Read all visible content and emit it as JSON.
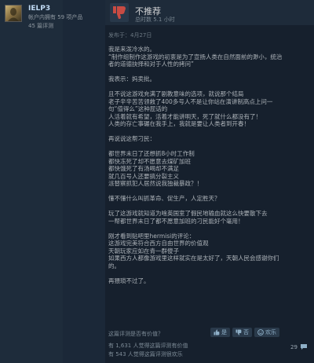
{
  "user": {
    "name": "IELP3",
    "games_owned": "帐户内拥有 59 项产品",
    "reviews_count": "45 篇评测"
  },
  "review": {
    "verdict": "不推荐",
    "hours": "总时数 5.1 小时",
    "posted": "发布于：4月27日",
    "lines": [
      "我是来泼冷水的。",
      "“制作组制作这游戏的初衷是为了宣扬人类在自然面前的渺小，统治",
      "者的道德抉择和对于人性的拷问”",
      "",
      "我表示：妈卖批。",
      "",
      "且不说这游戏充满了剧教意味的选项，就说那个结局",
      "老子辛辛苦苦领救了400多号人不是让你站在演讲制高点上问一",
      "句“值得么”这种屁话的",
      "人活着就有希望，活着才能讲明天，死了就什么都没有了！",
      "人类的存亡事碾在我手上，我就是要让人类者到开春！",
      "",
      "再说说这帮刁民：",
      "",
      "都世界末日了还想抓8小时工作制",
      "都快冻死了却不愿意去煤矿加班",
      "都快饿死了有汤喝却不满足",
      "就几百号人还要搞分裂主义",
      "派替察抓犯人居然说我独裁暴政？！",
      "",
      "懂不懂什么叫抓革命、促生产，人定胜天？",
      "",
      "玩了这游戏就知道为啥英国室了假民地输血就这么快要散下去",
      "一帮都世界末日了都不愿意加班的刁民能好个毫用！",
      "",
      "刚才看到贴吧里hermisi的评论：",
      "这游戏完美符合西方自由世界的价值观",
      "天朝玩家应如在青一群傻子",
      "如果西方人都像游戏里这样就实在是太好了，天朝人民会感谢你们",
      "的。",
      "",
      "再猥琐不过了。"
    ]
  },
  "footer": {
    "helpful_question": "这篇评测是否有价值？",
    "yes_label": "是",
    "no_label": "否",
    "funny_label": "欢乐",
    "helpful_stat": "有 1,631 人觉得这篇评测有价值",
    "funny_stat": "有 543 人觉得这篇评测很欢乐",
    "comments_count": "29"
  },
  "colors": {
    "background": "#1b2838",
    "card": "#16202d",
    "thumbs_down": "#c84b43"
  },
  "icons": {
    "thumbs_down": "thumbs-down-icon",
    "thumbs_up": "thumbs-up-icon",
    "funny": "smiley-icon",
    "comment": "speech-bubble-icon"
  }
}
